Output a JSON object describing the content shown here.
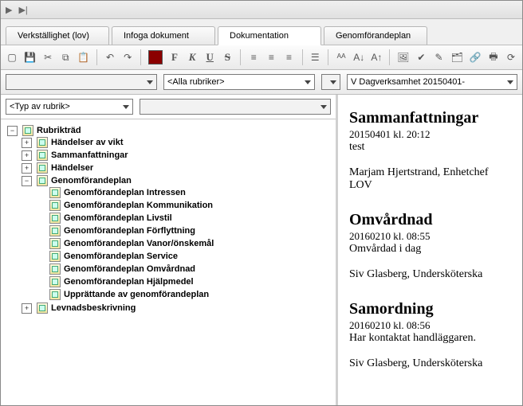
{
  "tabs": [
    {
      "label": "Verkställighet (lov)"
    },
    {
      "label": "Infoga dokument"
    },
    {
      "label": "Dokumentation"
    },
    {
      "label": "Genomförandeplan"
    }
  ],
  "active_tab_index": 2,
  "filters": {
    "ruler1": "",
    "ruler2": "<Alla rubriker>",
    "ruler3": "V Dagverksamhet 20150401-"
  },
  "typbar": {
    "typ": "<Typ av rubrik>",
    "blank": ""
  },
  "tree": {
    "root": "Rubrikträd",
    "nodes": [
      {
        "label": "Händelser av vikt"
      },
      {
        "label": "Sammanfattningar"
      },
      {
        "label": "Händelser"
      },
      {
        "label": "Genomförandeplan",
        "expanded": true,
        "children": [
          {
            "label": "Genomförandeplan  Intressen"
          },
          {
            "label": "Genomförandeplan Kommunikation"
          },
          {
            "label": "Genomförandeplan  Livstil"
          },
          {
            "label": "Genomförandeplan Förflyttning"
          },
          {
            "label": "Genomförandeplan Vanor/önskemål"
          },
          {
            "label": "Genomförandeplan  Service"
          },
          {
            "label": "Genomförandeplan Omvårdnad"
          },
          {
            "label": "Genomförandeplan Hjälpmedel"
          },
          {
            "label": "Upprättande av genomförandeplan"
          }
        ]
      },
      {
        "label": "Levnadsbeskrivning"
      }
    ]
  },
  "entries": [
    {
      "title": "Sammanfattningar",
      "meta": "20150401 kl. 20:12",
      "body": "test",
      "sig": "Marjam Hjertstrand, Enhetchef LOV"
    },
    {
      "title": "Omvårdnad",
      "meta": "20160210 kl. 08:55",
      "body": "Omvårdad i dag",
      "sig": "Siv Glasberg, Undersköterska"
    },
    {
      "title": "Samordning",
      "meta": "20160210 kl. 08:56",
      "body": "Har kontaktat handläggaren.",
      "sig": "Siv Glasberg, Undersköterska"
    }
  ],
  "toolbar_letters": {
    "F": "F",
    "K": "K",
    "U": "U",
    "S": "S"
  }
}
